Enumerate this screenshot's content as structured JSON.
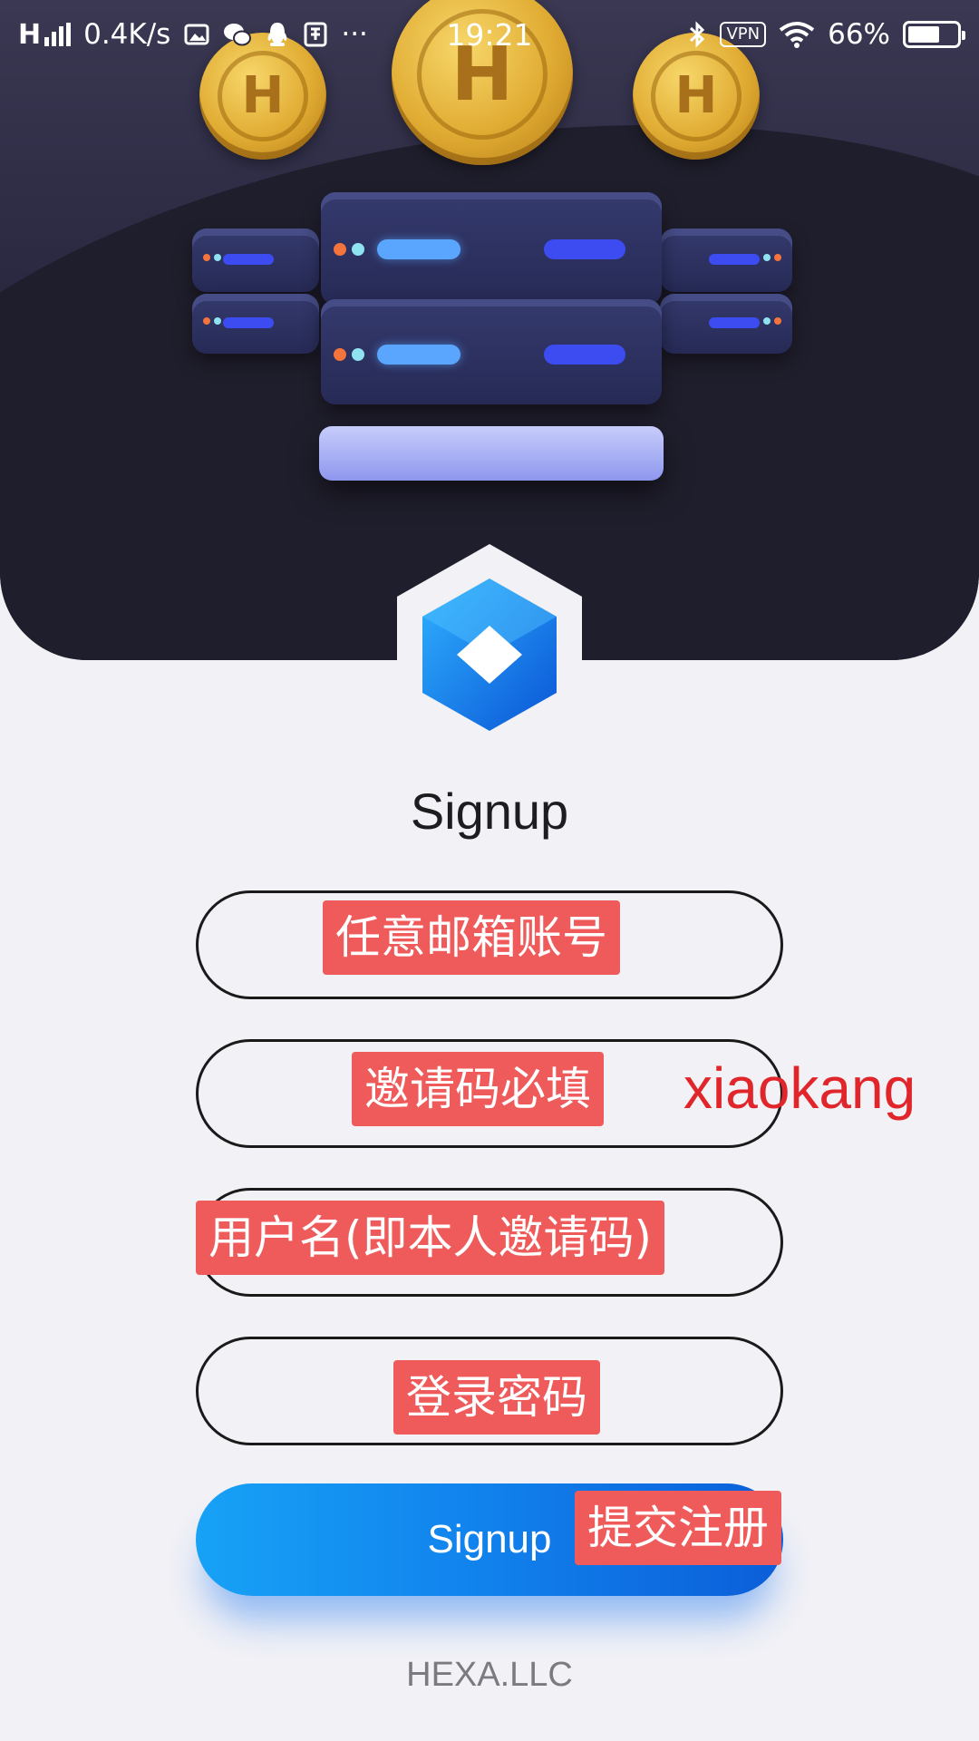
{
  "status_bar": {
    "network_speed": "0.4K/s",
    "time": "19:21",
    "vpn_label": "VPN",
    "battery": "66%",
    "battery_level": 0.66,
    "more": "···"
  },
  "hero": {
    "coin_letter": "H"
  },
  "page": {
    "title": "Signup",
    "footer": "HEXA.LLC"
  },
  "form": {
    "email_annotation": "任意邮箱账号",
    "invite_annotation": "邀请码必填",
    "invite_code_note": "xiaokang",
    "username_annotation": "用户名(即本人邀请码)",
    "password_annotation": "登录密码",
    "submit_label": "Signup",
    "submit_annotation": "提交注册"
  },
  "colors": {
    "accent": "#1181ec",
    "annotation_bg": "#ef5b5b",
    "annotation_text": "#e0252b",
    "hero_bg": "#2a2840"
  },
  "icons": [
    "signal-icon",
    "screenshot-icon",
    "wechat-icon",
    "qq-icon",
    "app-icon",
    "bluetooth-icon",
    "wifi-icon",
    "battery-icon"
  ]
}
